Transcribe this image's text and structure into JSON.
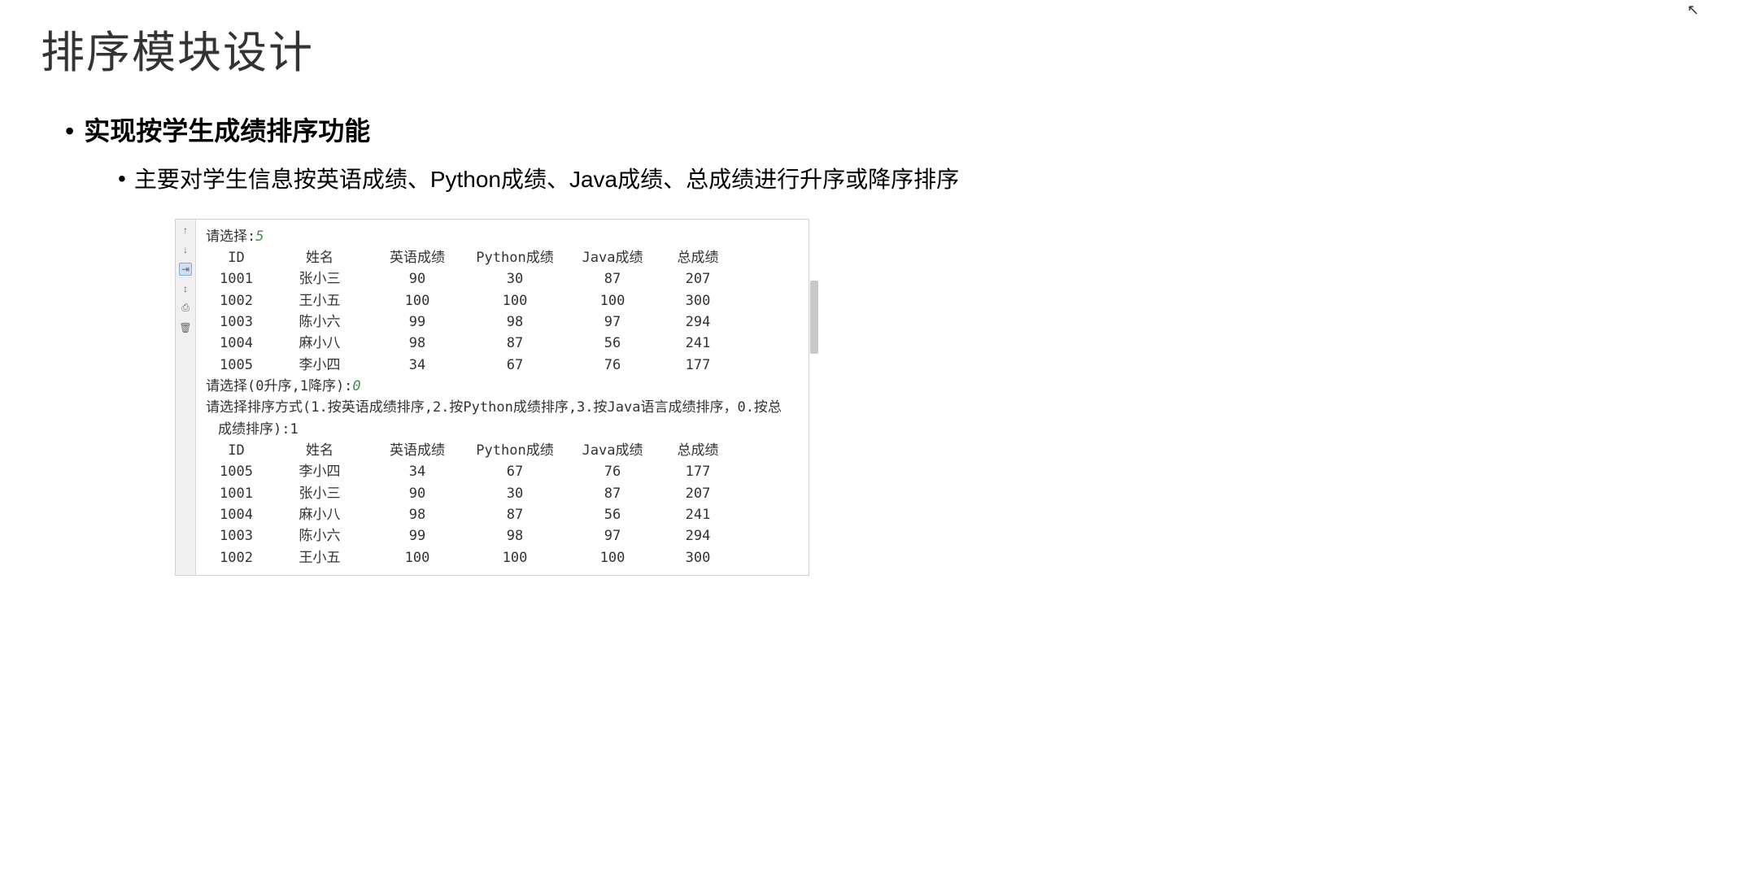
{
  "title": "排序模块设计",
  "bullet_main": "实现按学生成绩排序功能",
  "bullet_sub": "主要对学生信息按英语成绩、Python成绩、Java成绩、总成绩进行升序或降序排序",
  "console": {
    "prompt1_label": "请选择:",
    "prompt1_input": "5",
    "headers": {
      "id": "ID",
      "name": "姓名",
      "eng": "英语成绩",
      "py": "Python成绩",
      "java": "Java成绩",
      "total": "总成绩"
    },
    "rows1": [
      {
        "id": "1001",
        "name": "张小三",
        "eng": "90",
        "py": "30",
        "java": "87",
        "total": "207"
      },
      {
        "id": "1002",
        "name": "王小五",
        "eng": "100",
        "py": "100",
        "java": "100",
        "total": "300"
      },
      {
        "id": "1003",
        "name": "陈小六",
        "eng": "99",
        "py": "98",
        "java": "97",
        "total": "294"
      },
      {
        "id": "1004",
        "name": "麻小八",
        "eng": "98",
        "py": "87",
        "java": "56",
        "total": "241"
      },
      {
        "id": "1005",
        "name": "李小四",
        "eng": "34",
        "py": "67",
        "java": "76",
        "total": "177"
      }
    ],
    "prompt2_label": "请选择(0升序,1降序):",
    "prompt2_input": "0",
    "prompt3_label_a": "请选择排序方式(1.按英语成绩排序,2.按Python成绩排序,3.按Java语言成绩排序，0.按总",
    "prompt3_label_b": "成绩排序):",
    "prompt3_input": "1",
    "rows2": [
      {
        "id": "1005",
        "name": "李小四",
        "eng": "34",
        "py": "67",
        "java": "76",
        "total": "177"
      },
      {
        "id": "1001",
        "name": "张小三",
        "eng": "90",
        "py": "30",
        "java": "87",
        "total": "207"
      },
      {
        "id": "1004",
        "name": "麻小八",
        "eng": "98",
        "py": "87",
        "java": "56",
        "total": "241"
      },
      {
        "id": "1003",
        "name": "陈小六",
        "eng": "99",
        "py": "98",
        "java": "97",
        "total": "294"
      },
      {
        "id": "1002",
        "name": "王小五",
        "eng": "100",
        "py": "100",
        "java": "100",
        "total": "300"
      }
    ]
  },
  "toolbar_icons": [
    "↑",
    "↓",
    "⇥",
    "↕",
    "⎙",
    "🗑"
  ]
}
